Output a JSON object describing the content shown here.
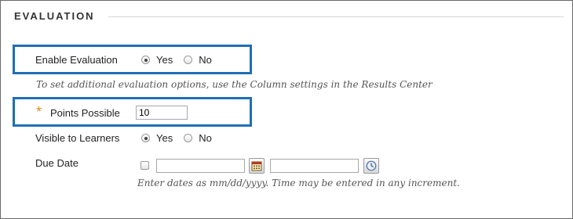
{
  "section": {
    "title": "EVALUATION"
  },
  "enable_evaluation": {
    "label": "Enable Evaluation",
    "yes_label": "Yes",
    "no_label": "No",
    "selected": "Yes"
  },
  "evaluation_hint": "To set additional evaluation options, use the Column settings in the Results Center",
  "points_possible": {
    "required_marker": "*",
    "label": "Points Possible",
    "value": "10"
  },
  "visible_to_learners": {
    "label": "Visible to Learners",
    "yes_label": "Yes",
    "no_label": "No",
    "selected": "Yes"
  },
  "due_date": {
    "label": "Due Date",
    "checked": false,
    "date_value": "",
    "time_value": "",
    "hint": "Enter dates as mm/dd/yyyy. Time may be entered in any increment."
  },
  "icons": {
    "calendar": "calendar-icon",
    "clock": "clock-icon"
  },
  "colors": {
    "highlight": "#1f6fb5",
    "required": "#e58a22",
    "border": "#6a6a6a"
  }
}
